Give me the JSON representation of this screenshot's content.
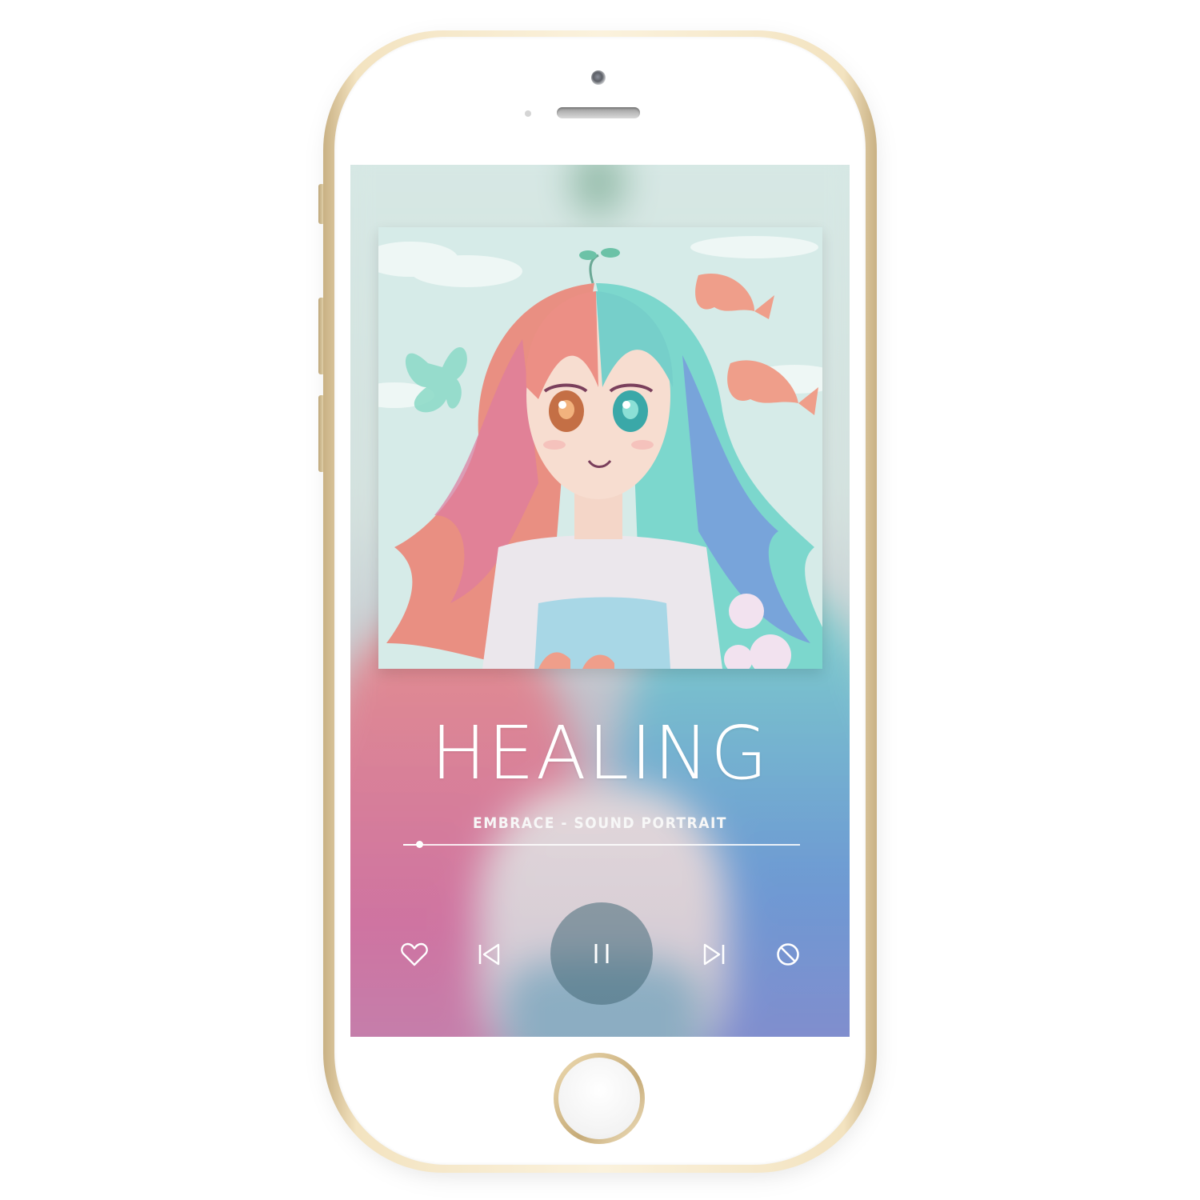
{
  "player": {
    "title": "HEALING",
    "subtitle": "EMBRACE - SOUND PORTRAIT",
    "progress_fraction": 0.02,
    "state": "playing"
  },
  "controls": {
    "like_icon": "heart-icon",
    "previous_icon": "skip-previous-icon",
    "play_pause_icon": "pause-icon",
    "next_icon": "skip-next-icon",
    "block_icon": "block-icon"
  },
  "artwork": {
    "description_icon": "album-art"
  },
  "colors": {
    "phone_gold": "#e9d5ac",
    "accent_button": "#466978",
    "text": "#ffffff"
  }
}
